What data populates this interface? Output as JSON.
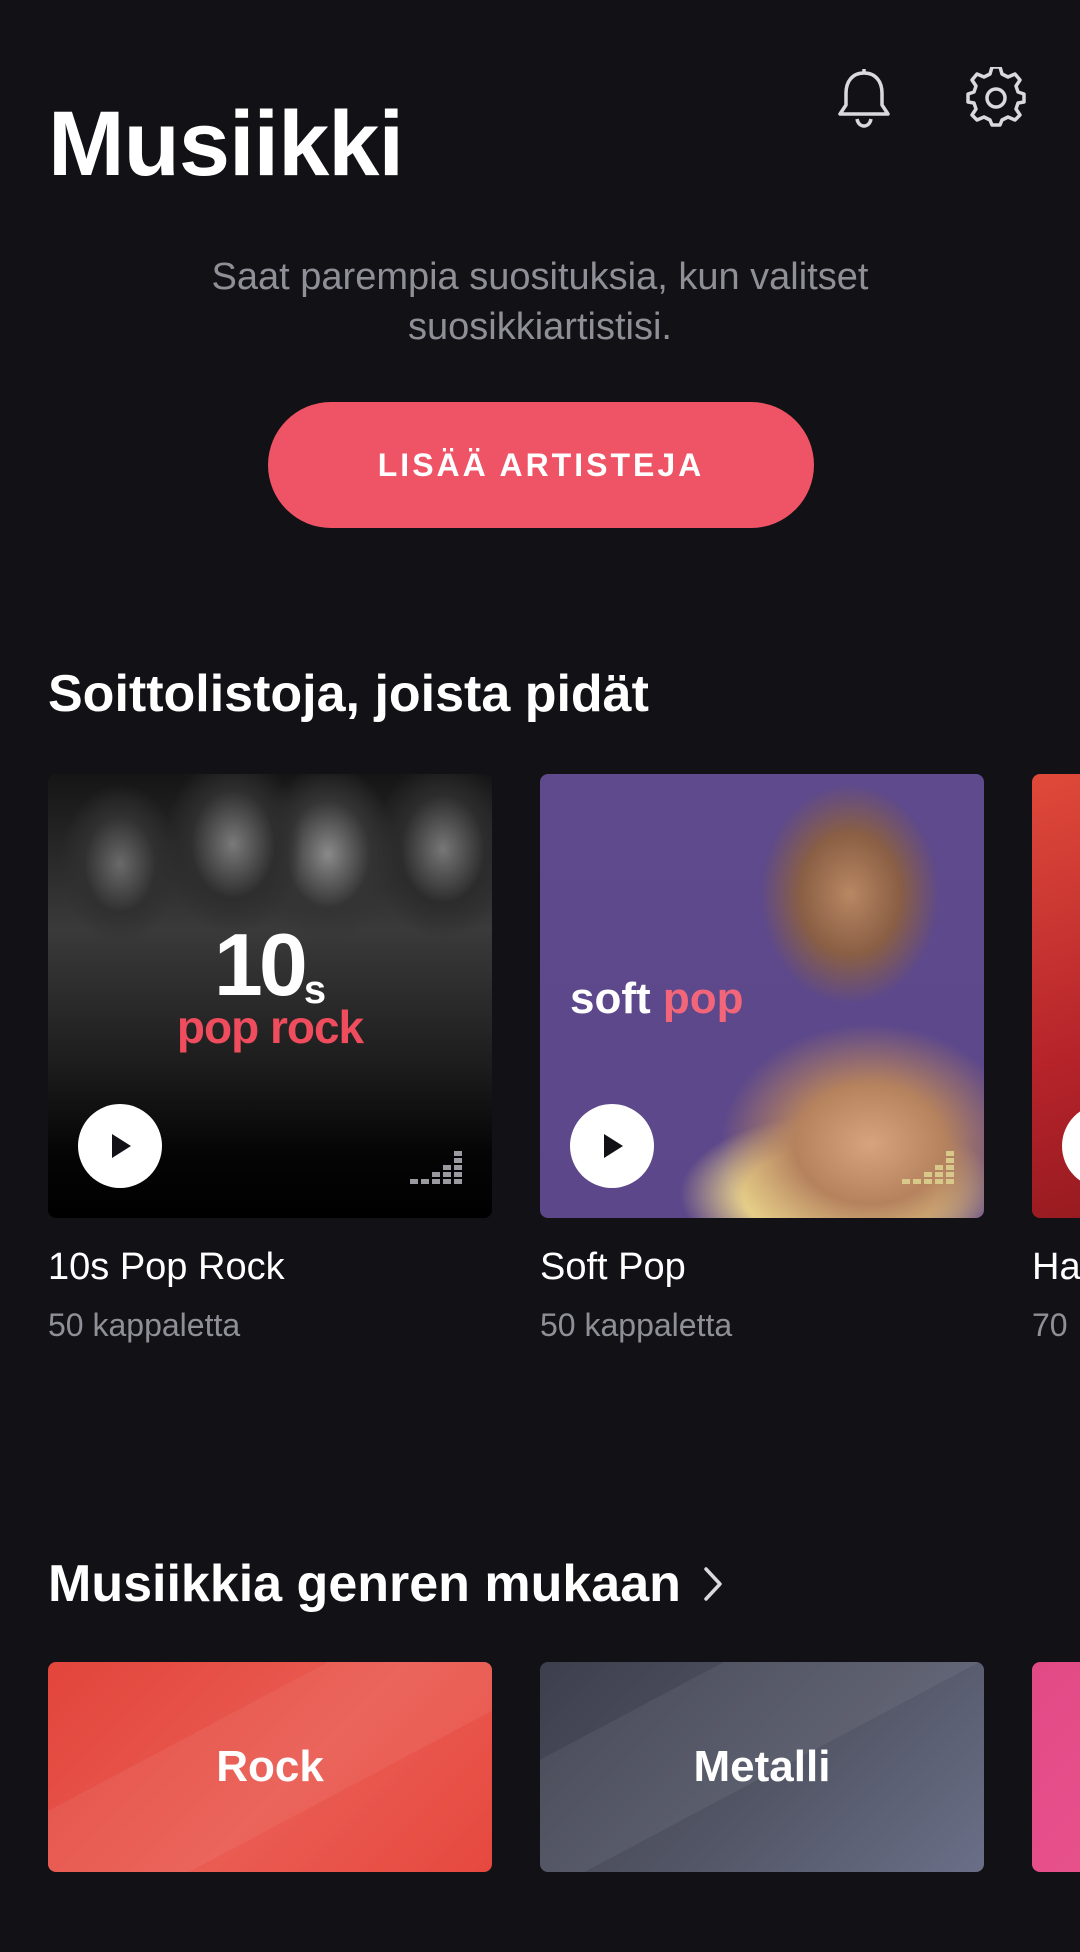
{
  "header": {
    "title": "Musiikki",
    "icons": {
      "notifications": "bell-icon",
      "settings": "gear-icon"
    }
  },
  "recommendation": {
    "line1": "Saat parempia suosituksia, kun valitset",
    "line2": "suosikkiartistisi.",
    "button_label": "LISÄÄ ARTISTEJA"
  },
  "playlists": {
    "title": "Soittolistoja, joista pidät",
    "items": [
      {
        "name": "10s Pop Rock",
        "count": "50 kappaletta",
        "cover_big": "10",
        "cover_small": "s",
        "cover_sub": "pop rock"
      },
      {
        "name": "Soft Pop",
        "count": "50 kappaletta",
        "cover_word1": "soft",
        "cover_word2": "pop"
      },
      {
        "name": "Ha",
        "count": "70"
      }
    ]
  },
  "genres": {
    "title": "Musiikkia genren mukaan",
    "items": [
      {
        "label": "Rock"
      },
      {
        "label": "Metalli"
      },
      {
        "label": ""
      }
    ]
  },
  "colors": {
    "background": "#121216",
    "accent": "#ef5466",
    "muted_text": "#8f8f97"
  }
}
